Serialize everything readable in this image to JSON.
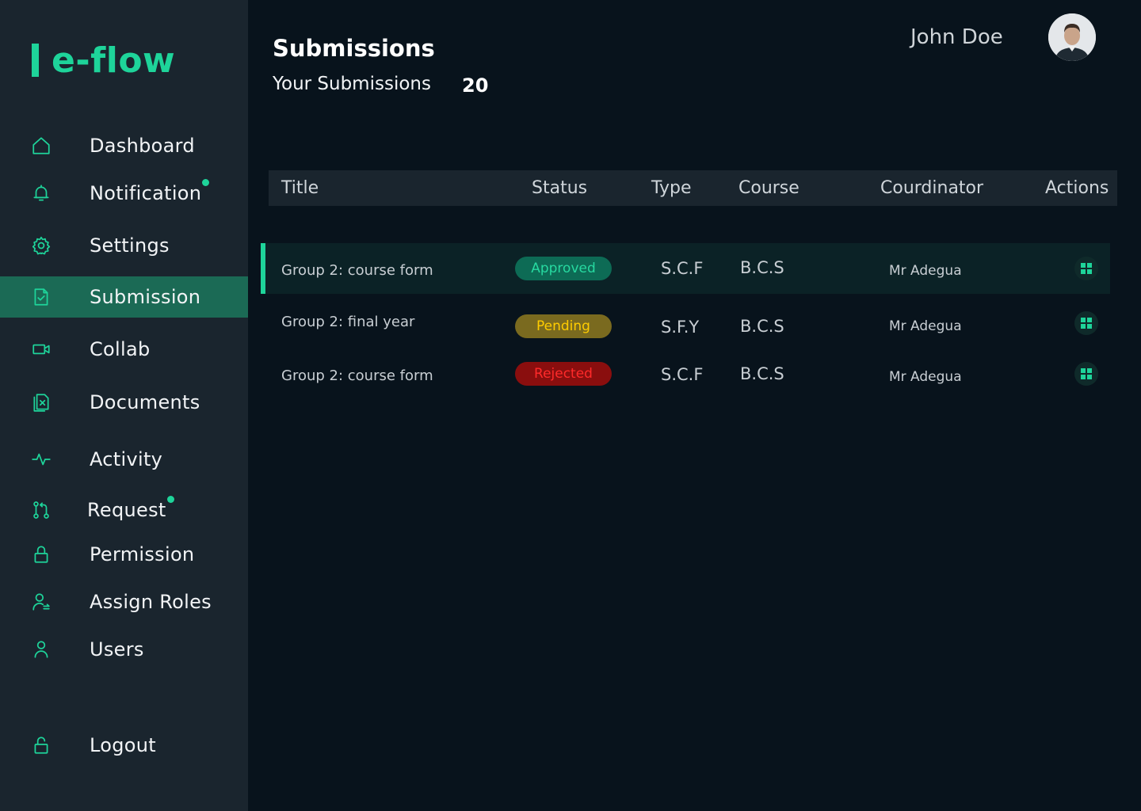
{
  "app": {
    "logo_text": "e-flow",
    "accent": "#1ed49a"
  },
  "sidebar": {
    "items": [
      {
        "label": "Dashboard",
        "icon": "home-icon",
        "dot": false,
        "active": false
      },
      {
        "label": "Notification",
        "icon": "bell-icon",
        "dot": true,
        "active": false
      },
      {
        "label": "Settings",
        "icon": "gear-icon",
        "dot": false,
        "active": false
      },
      {
        "label": "Submission",
        "icon": "file-check-icon",
        "dot": false,
        "active": true
      },
      {
        "label": "Collab",
        "icon": "video-icon",
        "dot": false,
        "active": false
      },
      {
        "label": "Documents",
        "icon": "documents-icon",
        "dot": false,
        "active": false
      },
      {
        "label": "Activity",
        "icon": "activity-icon",
        "dot": false,
        "active": false
      },
      {
        "label": "Request",
        "icon": "pull-request-icon",
        "dot": true,
        "active": false
      },
      {
        "label": "Permission",
        "icon": "lock-icon",
        "dot": false,
        "active": false
      },
      {
        "label": "Assign Roles",
        "icon": "user-assign-icon",
        "dot": false,
        "active": false
      },
      {
        "label": "Users",
        "icon": "user-icon",
        "dot": false,
        "active": false
      }
    ],
    "logout": {
      "label": "Logout",
      "icon": "unlock-icon"
    }
  },
  "header": {
    "title": "Submissions",
    "subtitle": "Your Submissions",
    "count": "20",
    "user_name": "John Doe"
  },
  "table": {
    "columns": [
      "Title",
      "Status",
      "Type",
      "Course",
      "Courdinator",
      "Actions"
    ],
    "rows": [
      {
        "title": "Group 2: course form",
        "status": "Approved",
        "type": "S.C.F",
        "course": "B.C.S",
        "coordinator": "Mr Adegua"
      },
      {
        "title": "Group 2: final year",
        "status": "Pending",
        "type": "S.F.Y",
        "course": "B.C.S",
        "coordinator": "Mr Adegua"
      },
      {
        "title": "Group 2: course form",
        "status": "Rejected",
        "type": "S.C.F",
        "course": "B.C.S",
        "coordinator": "Mr Adegua"
      }
    ]
  },
  "status_colors": {
    "Approved": {
      "bg": "#0d6b55",
      "fg": "#27d9a0"
    },
    "Pending": {
      "bg": "#7a6a1f",
      "fg": "#ffcc00"
    },
    "Rejected": {
      "bg": "#8a0e0e",
      "fg": "#ff2a2a"
    }
  }
}
